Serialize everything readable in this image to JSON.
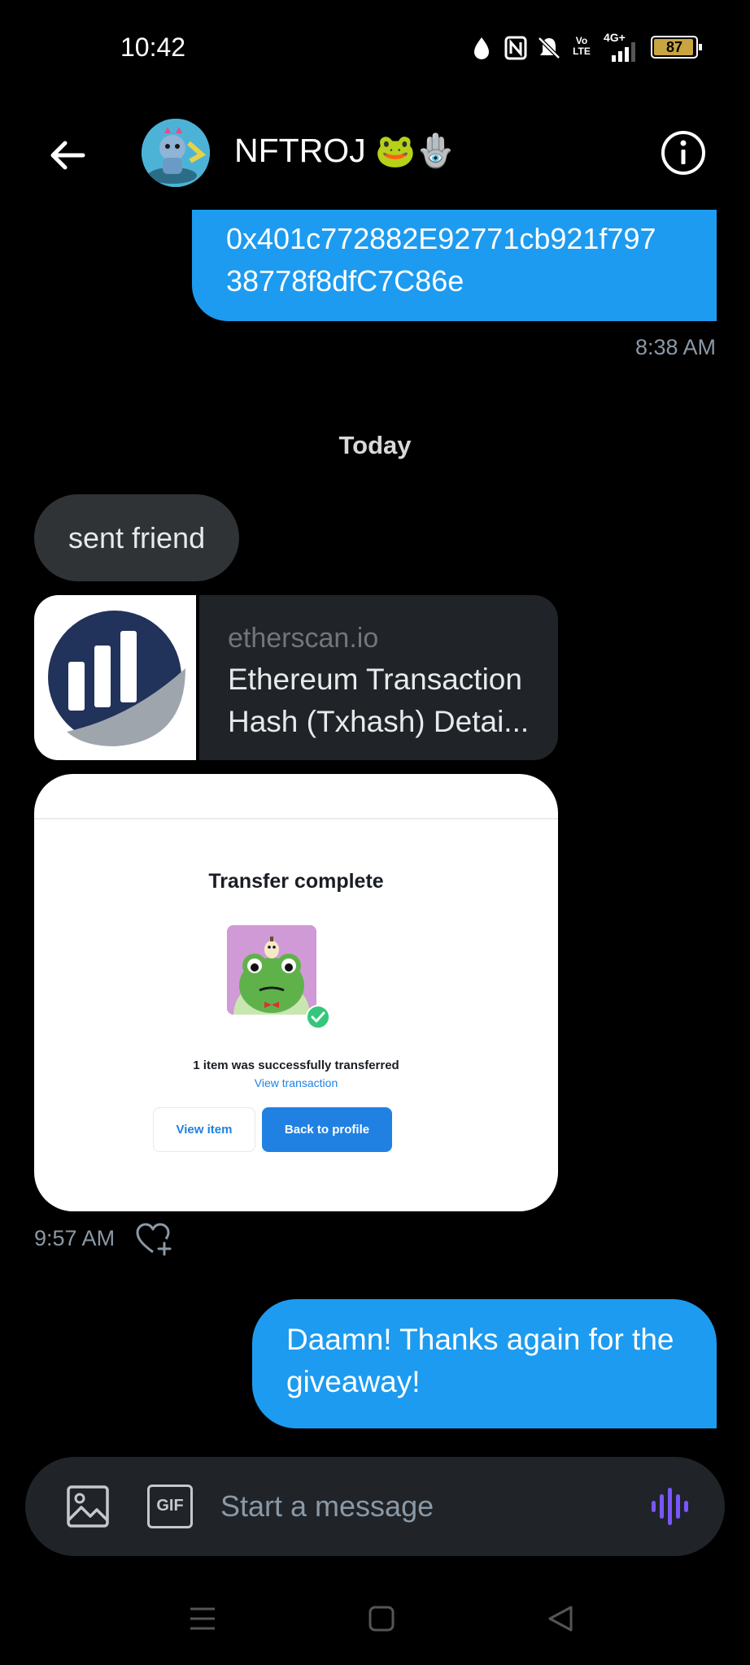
{
  "status_bar": {
    "time": "10:42",
    "network": "4G+",
    "volte": "Vo LTE",
    "battery": "87"
  },
  "header": {
    "name": "NFTROJ",
    "emoji": "🐸🪬"
  },
  "messages": {
    "address": {
      "line1": "0x401c772882E92771cb921f797",
      "line2": "38778f8dfC7C86e",
      "time": "8:38 AM"
    },
    "day_separator": "Today",
    "sent_friend": "sent friend",
    "link_preview": {
      "domain": "etherscan.io",
      "title": "Ethereum Transaction Hash (Txhash) Detai..."
    },
    "image_card": {
      "title": "Transfer complete",
      "message": "1 item was successfully transferred",
      "link": "View transaction",
      "view_item": "View item",
      "back_to_profile": "Back to profile"
    },
    "incoming_time": "9:57 AM",
    "giveaway": "Daamn! Thanks again for the giveaway!"
  },
  "composer": {
    "placeholder": "Start a message",
    "gif_label": "GIF"
  },
  "colors": {
    "accent": "#1d9bf0",
    "incoming_bubble": "#2f3336",
    "voice": "#7856ff"
  }
}
